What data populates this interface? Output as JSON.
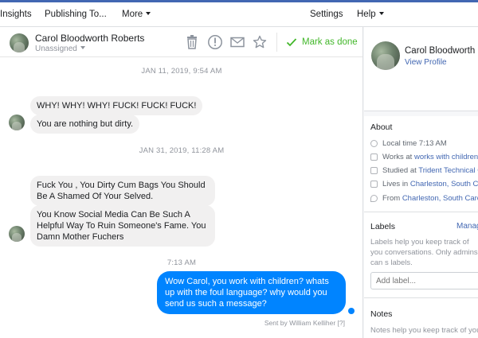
{
  "topnav": {
    "insights": "Insights",
    "publishing": "Publishing To...",
    "more": "More",
    "settings": "Settings",
    "help": "Help"
  },
  "conversation": {
    "name": "Carol Bloodworth Roberts",
    "assignment": "Unassigned",
    "mark_done": "Mark as done",
    "icons": [
      "trash-icon",
      "spam-icon",
      "mail-icon",
      "star-icon",
      "check-icon"
    ],
    "messages": [
      {
        "type": "date",
        "text": "JAN 11, 2019, 9:54 AM"
      },
      {
        "type": "in",
        "text": "WHY! WHY! WHY! FUCK! FUCK! FUCK!"
      },
      {
        "type": "in",
        "text": "You are nothing but dirty."
      },
      {
        "type": "date",
        "text": "JAN 31, 2019, 11:28 AM"
      },
      {
        "type": "in",
        "text": "Fuck You , You Dirty Cum Bags You Should Be A Shamed Of Your Selved."
      },
      {
        "type": "in",
        "text": "You Know Social Media Can Be Such A Helpful Way To Ruin Someone's Fame. You Damn Mother Fuchers"
      },
      {
        "type": "date",
        "text": "7:13 AM"
      },
      {
        "type": "out",
        "text": "Wow Carol, you work with children? whats up with the foul language? why would you send us such a message?"
      }
    ],
    "sent_by": "Sent by William Kelliher",
    "sent_by_help": "[?]"
  },
  "profile": {
    "name": "Carol Bloodworth Roberts",
    "view_profile": "View Profile",
    "about_title": "About",
    "about": [
      {
        "icon": "clock-icon",
        "prefix": "Local time 7:13 AM",
        "link": ""
      },
      {
        "icon": "briefcase-icon",
        "prefix": "Works at ",
        "link": "works with children"
      },
      {
        "icon": "graduation-icon",
        "prefix": "Studied at ",
        "link": "Trident Technical C"
      },
      {
        "icon": "home-icon",
        "prefix": "Lives in ",
        "link": "Charleston, South Ca"
      },
      {
        "icon": "location-icon",
        "prefix": "From ",
        "link": "Charleston, South Carol"
      }
    ],
    "labels_title": "Labels",
    "labels_manage": "Manag",
    "labels_help": "Labels help you keep track of you conversations. Only admins can s labels.",
    "add_label_placeholder": "Add label...",
    "notes_title": "Notes",
    "notes_help": "Notes help you keep track of you"
  },
  "colors": {
    "accent": "#4267b2",
    "outgoing_bubble": "#0084ff",
    "incoming_bubble": "#f1f0f0",
    "done_green": "#42b72a"
  }
}
